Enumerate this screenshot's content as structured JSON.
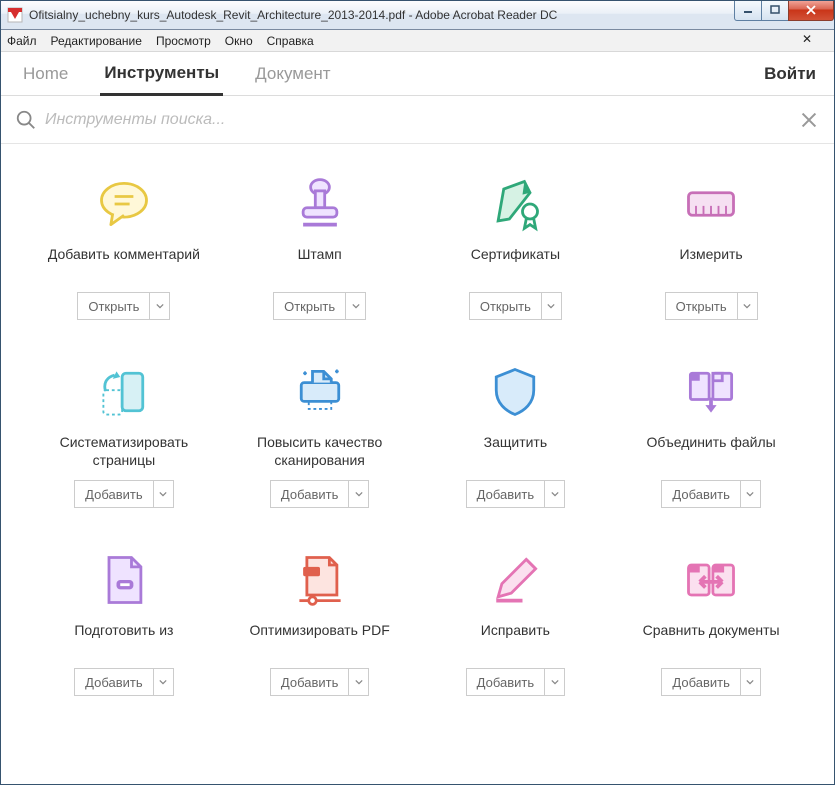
{
  "window_title": "Ofitsialny_uchebny_kurs_Autodesk_Revit_Architecture_2013-2014.pdf - Adobe Acrobat Reader DC",
  "menu": {
    "file": "Файл",
    "edit": "Редактирование",
    "view": "Просмотр",
    "window": "Окно",
    "help": "Справка"
  },
  "nav": {
    "home": "Home",
    "tools": "Инструменты",
    "document": "Документ",
    "login": "Войти"
  },
  "search": {
    "placeholder": "Инструменты поиска..."
  },
  "btn": {
    "open": "Открыть",
    "add": "Добавить"
  },
  "cards": {
    "comment": {
      "title": "Добавить комментарий"
    },
    "stamp": {
      "title": "Штамп"
    },
    "certs": {
      "title": "Сертификаты"
    },
    "measure": {
      "title": "Измерить"
    },
    "organize": {
      "title": "Систематизировать страницы"
    },
    "enhance": {
      "title": "Повысить качество сканирования"
    },
    "protect": {
      "title": "Защитить"
    },
    "combine": {
      "title": "Объединить файлы"
    },
    "prepare": {
      "title": "Подготовить из"
    },
    "optimize": {
      "title": "Оптимизировать PDF"
    },
    "fix": {
      "title": "Исправить"
    },
    "compare": {
      "title": "Сравнить документы"
    }
  }
}
